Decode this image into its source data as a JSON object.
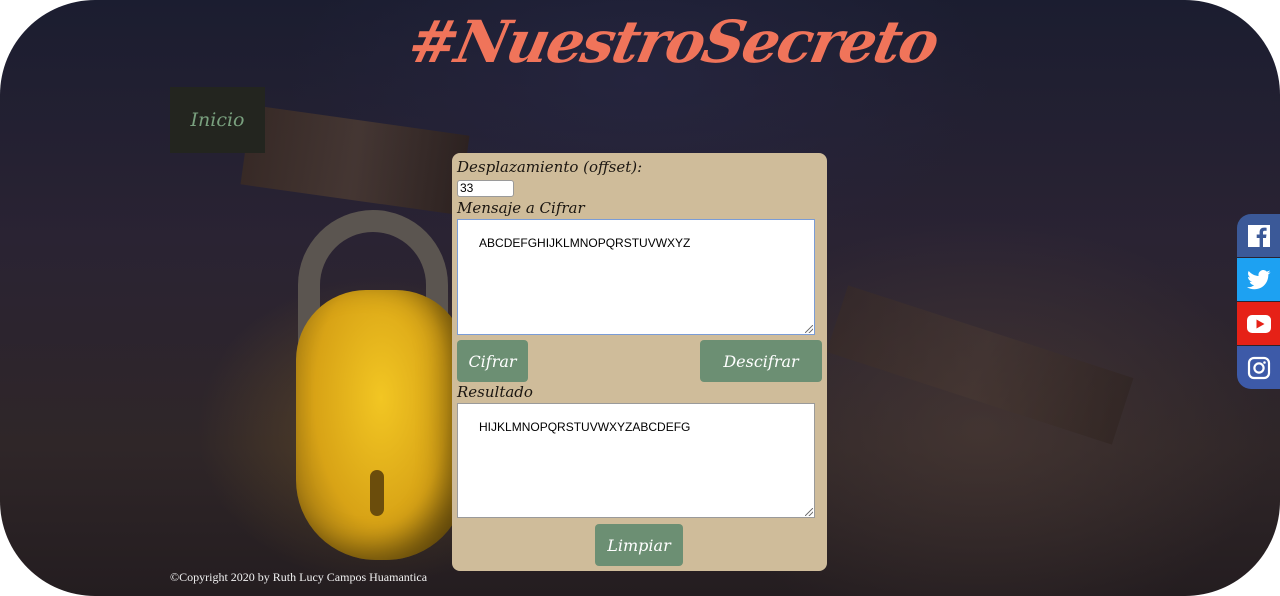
{
  "header": {
    "title": "#NuestroSecreto"
  },
  "nav": {
    "inicio_label": "Inicio"
  },
  "form": {
    "offset_label": "Desplazamiento (offset):",
    "offset_value": "33",
    "message_label": "Mensaje a Cifrar",
    "message_value": "ABCDEFGHIJKLMNOPQRSTUVWXYZ",
    "encrypt_label": "Cifrar",
    "decrypt_label": "Descifrar",
    "result_label": "Resultado",
    "result_value": "HIJKLMNOPQRSTUVWXYZABCDEFG",
    "clear_label": "Limpiar"
  },
  "footer": {
    "copyright": "©Copyright 2020 by Ruth Lucy Campos Huamantica"
  },
  "social": [
    {
      "icon": "facebook-icon",
      "color": "#3b5998"
    },
    {
      "icon": "twitter-icon",
      "color": "#1da1f2"
    },
    {
      "icon": "youtube-icon",
      "color": "#e62117"
    },
    {
      "icon": "instagram-icon",
      "color": "#3d5aa8"
    }
  ],
  "colors": {
    "title": "#f0745a",
    "panel": "#cfbc9a",
    "button": "#6c8f73",
    "nav_bg": "#23251f",
    "nav_text": "#79a07e"
  }
}
